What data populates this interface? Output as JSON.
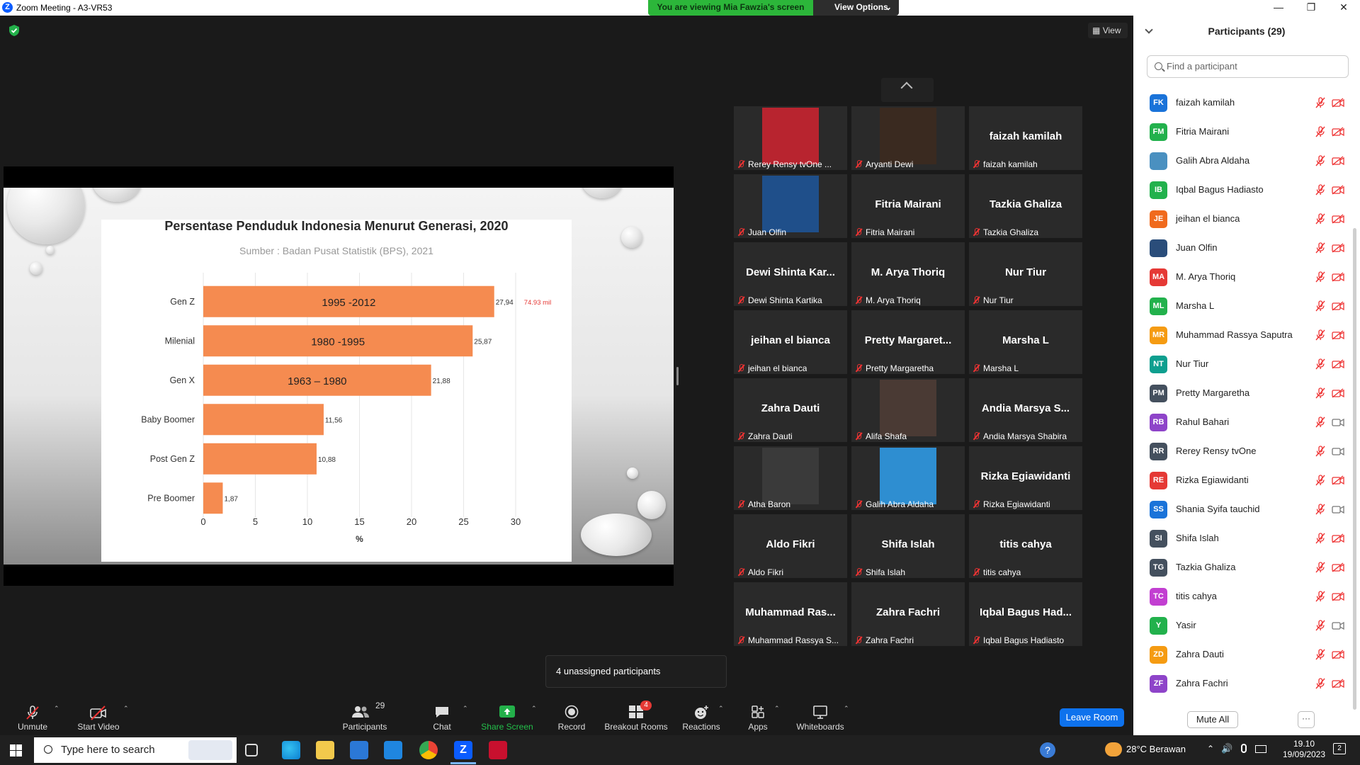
{
  "window": {
    "title": "Zoom Meeting - A3-VR53"
  },
  "banner": {
    "viewing": "You are viewing Mia Fawzia's screen",
    "view_options": "View Options"
  },
  "view_button": "View",
  "slide": {
    "chart_data": {
      "type": "bar",
      "orientation": "horizontal",
      "title": "Persentase Penduduk Indonesia Menurut Generasi, 2020",
      "subtitle": "Sumber : Badan Pusat Statistik (BPS), 2021",
      "xlabel": "%",
      "xlim": [
        0,
        30
      ],
      "xticks": [
        "0",
        "5",
        "10",
        "15",
        "20",
        "25",
        "30"
      ],
      "categories": [
        "Gen Z",
        "Milenial",
        "Gen X",
        "Baby Boomer",
        "Post Gen Z",
        "Pre Boomer"
      ],
      "values": [
        27.94,
        25.87,
        21.88,
        11.56,
        10.88,
        1.87
      ],
      "value_labels": [
        "27,94",
        "25,87",
        "21,88",
        "11,56",
        "10,88",
        "1,87"
      ],
      "bar_annotations": [
        "1995 -2012",
        "1980 -1995",
        "1963 – 1980",
        "",
        "",
        ""
      ],
      "extra_annotation": "74.93 mil",
      "bar_color": "#f58b50",
      "grid": "vertical"
    }
  },
  "gallery": {
    "tiles": [
      {
        "big": "",
        "label": "Rerey Rensy tvOne ..."
      },
      {
        "big": "",
        "label": "Aryanti Dewi"
      },
      {
        "big": "faizah kamilah",
        "label": "faizah kamilah"
      },
      {
        "big": "",
        "label": "Juan Olfin"
      },
      {
        "big": "Fitria Mairani",
        "label": "Fitria Mairani"
      },
      {
        "big": "Tazkia Ghaliza",
        "label": "Tazkia Ghaliza"
      },
      {
        "big": "Dewi Shinta Kar...",
        "label": "Dewi Shinta Kartika"
      },
      {
        "big": "M. Arya Thoriq",
        "label": "M. Arya Thoriq"
      },
      {
        "big": "Nur Tiur",
        "label": "Nur Tiur"
      },
      {
        "big": "jeihan el bianca",
        "label": "jeihan el bianca"
      },
      {
        "big": "Pretty Margaret...",
        "label": "Pretty Margaretha"
      },
      {
        "big": "Marsha L",
        "label": "Marsha L"
      },
      {
        "big": "Zahra Dauti",
        "label": "Zahra Dauti"
      },
      {
        "big": "",
        "label": "Alifa Shafa"
      },
      {
        "big": "Andia Marsya S...",
        "label": "Andia Marsya Shabira"
      },
      {
        "big": "",
        "label": "Atha Baron"
      },
      {
        "big": "",
        "label": "Galih Abra Aldaha"
      },
      {
        "big": "Rizka Egiawidanti",
        "label": "Rizka Egiawidanti"
      },
      {
        "big": "Aldo Fikri",
        "label": "Aldo Fikri"
      },
      {
        "big": "Shifa Islah",
        "label": "Shifa Islah"
      },
      {
        "big": "titis cahya",
        "label": "titis cahya"
      },
      {
        "big": "Muhammad Ras...",
        "label": "Muhammad Rassya S..."
      },
      {
        "big": "Zahra Fachri",
        "label": "Zahra Fachri"
      },
      {
        "big": "Iqbal Bagus Had...",
        "label": "Iqbal Bagus Hadiasto"
      }
    ]
  },
  "toast": "4 unassigned participants",
  "toolbar": {
    "unmute": "Unmute",
    "start_video": "Start Video",
    "participants": "Participants",
    "participants_count": "29",
    "chat": "Chat",
    "share_screen": "Share Screen",
    "record": "Record",
    "breakout_rooms": "Breakout Rooms",
    "breakout_badge": "4",
    "reactions": "Reactions",
    "apps": "Apps",
    "whiteboards": "Whiteboards",
    "leave_room": "Leave Room"
  },
  "panel": {
    "title": "Participants (29)",
    "search_placeholder": "Find a participant",
    "mute_all": "Mute All",
    "more": "···",
    "participants": [
      {
        "initials": "FK",
        "name": "faizah kamilah",
        "color": "#1a73d9",
        "cam": "off"
      },
      {
        "initials": "FM",
        "name": "Fitria Mairani",
        "color": "#22b14c",
        "cam": "off"
      },
      {
        "initials": "",
        "name": "Galih Abra Aldaha",
        "color": "#4a90c0",
        "cam": "off"
      },
      {
        "initials": "IB",
        "name": "Iqbal Bagus Hadiasto",
        "color": "#22b14c",
        "cam": "off"
      },
      {
        "initials": "JE",
        "name": "jeihan el bianca",
        "color": "#f06a1d",
        "cam": "off"
      },
      {
        "initials": "",
        "name": "Juan Olfin",
        "color": "#2a4d7a",
        "cam": "off"
      },
      {
        "initials": "MA",
        "name": "M. Arya Thoriq",
        "color": "#e53935",
        "cam": "off"
      },
      {
        "initials": "ML",
        "name": "Marsha L",
        "color": "#22b14c",
        "cam": "off"
      },
      {
        "initials": "MR",
        "name": "Muhammad Rassya Saputra",
        "color": "#f59b12",
        "cam": "off"
      },
      {
        "initials": "NT",
        "name": "Nur Tiur",
        "color": "#0e9f8f",
        "cam": "off"
      },
      {
        "initials": "PM",
        "name": "Pretty Margaretha",
        "color": "#44505e",
        "cam": "off"
      },
      {
        "initials": "RB",
        "name": "Rahul Bahari",
        "color": "#8e44c9",
        "cam": "on"
      },
      {
        "initials": "RR",
        "name": "Rerey Rensy tvOne",
        "color": "#44505e",
        "cam": "on"
      },
      {
        "initials": "RE",
        "name": "Rizka Egiawidanti",
        "color": "#e53935",
        "cam": "off"
      },
      {
        "initials": "SS",
        "name": "Shania Syifa tauchid",
        "color": "#1a73d9",
        "cam": "on"
      },
      {
        "initials": "SI",
        "name": "Shifa Islah",
        "color": "#44505e",
        "cam": "off"
      },
      {
        "initials": "TG",
        "name": "Tazkia Ghaliza",
        "color": "#44505e",
        "cam": "off"
      },
      {
        "initials": "TC",
        "name": "titis cahya",
        "color": "#c23fd1",
        "cam": "off"
      },
      {
        "initials": "Y",
        "name": "Yasir",
        "color": "#22b14c",
        "cam": "on"
      },
      {
        "initials": "ZD",
        "name": "Zahra Dauti",
        "color": "#f59b12",
        "cam": "off"
      },
      {
        "initials": "ZF",
        "name": "Zahra Fachri",
        "color": "#8e44c9",
        "cam": "off"
      }
    ]
  },
  "taskbar": {
    "search_placeholder": "Type here to search",
    "weather": "28°C  Berawan",
    "time": "19.10",
    "date": "19/09/2023",
    "notifications": "2"
  }
}
